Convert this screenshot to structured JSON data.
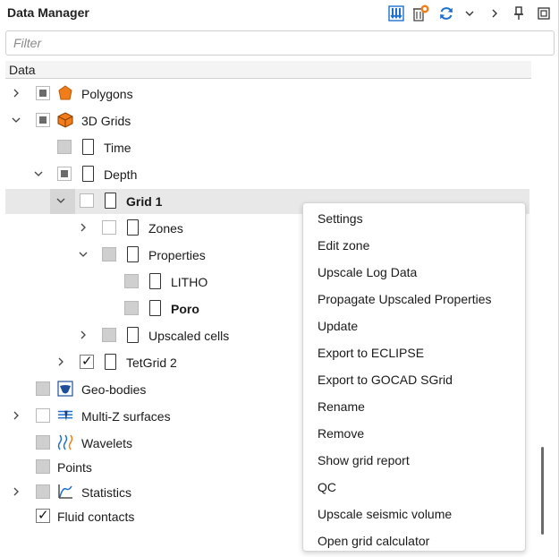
{
  "header": {
    "title": "Data Manager",
    "icons": [
      "insert-data-icon",
      "delete-data-icon",
      "refresh-icon",
      "chevron-down-icon",
      "chevron-right-icon",
      "pin-icon",
      "float-window-icon"
    ]
  },
  "filter": {
    "placeholder": "Filter"
  },
  "column_header": "Data",
  "tree": [
    {
      "label": "Polygons",
      "level": 0,
      "expander": "collapsed",
      "check": "partial-dark",
      "icon": "polygon-icon",
      "bold": false
    },
    {
      "label": "3D Grids",
      "level": 0,
      "expander": "expanded",
      "check": "partial-dark",
      "icon": "3d-grid-icon",
      "bold": false
    },
    {
      "label": "Time",
      "level": 1,
      "expander": "none",
      "check": "partial",
      "icon": "folder-icon",
      "bold": false
    },
    {
      "label": "Depth",
      "level": 1,
      "expander": "expanded",
      "check": "partial-dark",
      "icon": "folder-icon",
      "bold": false
    },
    {
      "label": "Grid 1",
      "level": 2,
      "expander": "expanded",
      "check": "empty",
      "icon": "grid-icon",
      "bold": true
    },
    {
      "label": "Zones",
      "level": 3,
      "expander": "collapsed",
      "check": "empty",
      "icon": "zones-icon",
      "bold": false
    },
    {
      "label": "Properties",
      "level": 3,
      "expander": "expanded",
      "check": "partial",
      "icon": "properties-icon",
      "bold": false
    },
    {
      "label": "LITHO",
      "level": 4,
      "expander": "none",
      "check": "partial",
      "icon": "property-icon",
      "bold": false
    },
    {
      "label": "Poro",
      "level": 4,
      "expander": "none",
      "check": "partial",
      "icon": "property-icon",
      "bold": true
    },
    {
      "label": "Upscaled cells",
      "level": 3,
      "expander": "collapsed",
      "check": "partial",
      "icon": "upscaled-cells-icon",
      "bold": false
    },
    {
      "label": "TetGrid 2",
      "level": 2,
      "expander": "collapsed",
      "check": "checked",
      "icon": "tetgrid-icon",
      "bold": false
    },
    {
      "label": "Geo-bodies",
      "level": 0,
      "expander": "none",
      "check": "partial",
      "icon": "geo-bodies-icon",
      "bold": false
    },
    {
      "label": "Multi-Z surfaces",
      "level": 0,
      "expander": "collapsed",
      "check": "empty",
      "icon": "multi-z-surfaces-icon",
      "bold": false
    },
    {
      "label": "Wavelets",
      "level": 0,
      "expander": "none",
      "check": "partial",
      "icon": "wavelet-icon",
      "bold": false
    },
    {
      "label": "Points",
      "level": 0,
      "expander": "none",
      "check": "partial",
      "icon": "",
      "bold": false
    },
    {
      "label": "Statistics",
      "level": 0,
      "expander": "collapsed",
      "check": "partial",
      "icon": "statistics-icon",
      "bold": false
    },
    {
      "label": "Fluid contacts",
      "level": 0,
      "expander": "none",
      "check": "checked",
      "icon": "",
      "bold": false
    }
  ],
  "context_menu": [
    "Settings",
    "Edit zone",
    "Upscale Log Data",
    "Propagate Upscaled Properties",
    "Update",
    "Export to ECLIPSE",
    "Export to GOCAD SGrid",
    "Rename",
    "Remove",
    "Show grid report",
    "QC",
    "Upscale seismic volume",
    "Open grid calculator"
  ],
  "colors": {
    "accent": "#1f6fd1",
    "orange": "#f07d1a",
    "selection": "#e8e8e8"
  }
}
